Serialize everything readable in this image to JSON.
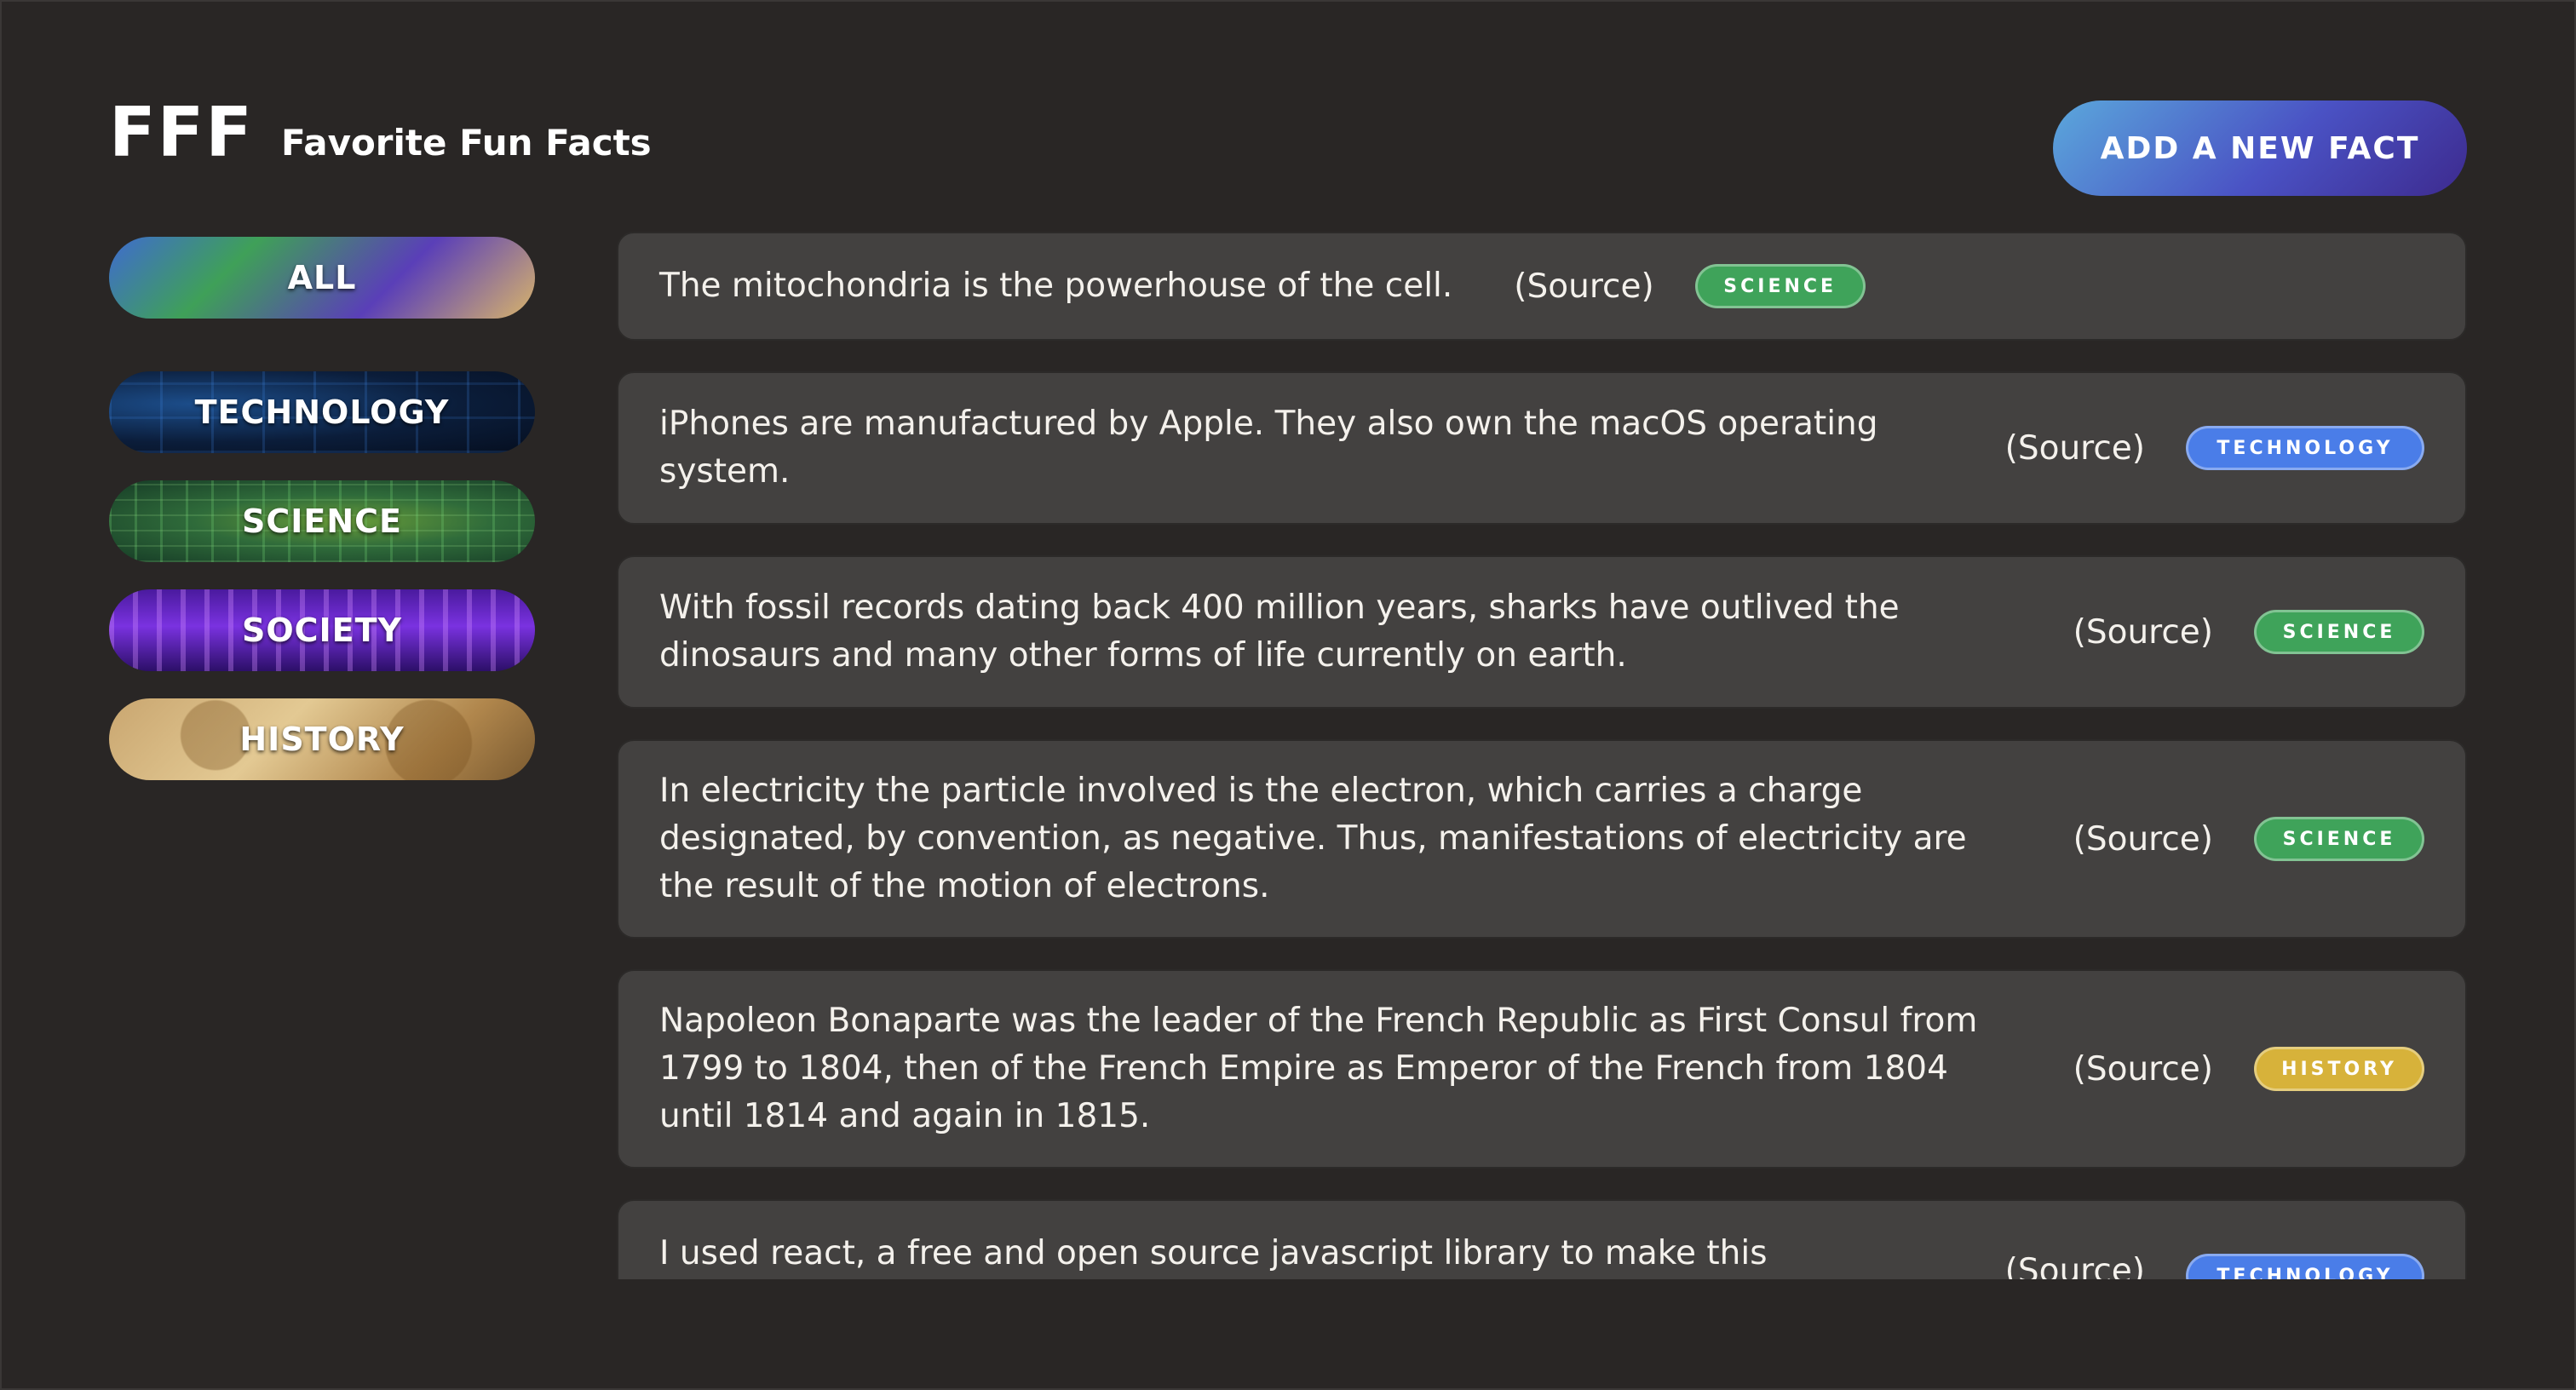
{
  "header": {
    "logo": "FFF",
    "tagline": "Favorite Fun Facts",
    "add_button": "Add a new fact"
  },
  "sidebar": {
    "categories": [
      {
        "label": "All"
      },
      {
        "label": "Technology"
      },
      {
        "label": "Science"
      },
      {
        "label": "Society"
      },
      {
        "label": "History"
      }
    ]
  },
  "colors": {
    "background": "#292625",
    "card": "#434140",
    "science": "#3fa35a",
    "technology": "#4a7de8",
    "history": "#d7b23a"
  },
  "facts": [
    {
      "text": "The mitochondria is the powerhouse of the cell.",
      "source": "(Source)",
      "category": "science"
    },
    {
      "text": "iPhones are manufactured by Apple. They also own the macOS operating system.",
      "source": "(Source)",
      "category": "technology"
    },
    {
      "text": "With fossil records dating back 400 million years, sharks have outlived the dinosaurs and many other forms of life currently on earth.",
      "source": "(Source)",
      "category": "science"
    },
    {
      "text": "In electricity the particle involved is the electron, which carries a charge designated, by convention, as negative. Thus, manifestations of electricity are the result of the motion of electrons.",
      "source": "(Source)",
      "category": "science"
    },
    {
      "text": "Napoleon Bonaparte was the leader of the French Republic as First Consul from 1799 to 1804, then of the French Empire as Emperor of the French from 1804 until 1814 and again in 1815.",
      "source": "(Source)",
      "category": "history"
    },
    {
      "text": "I used react, a free and open source javascript library to make this website.",
      "source": "(Source)",
      "category": "technology"
    }
  ]
}
